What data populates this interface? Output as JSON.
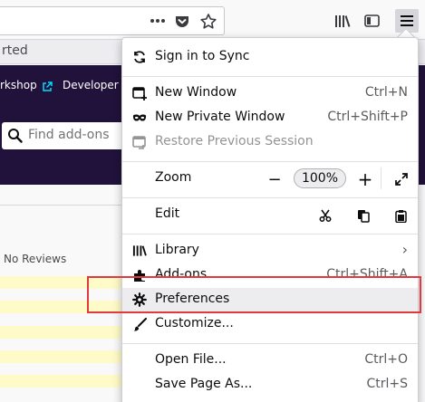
{
  "toolbar": {
    "icons": [
      "page-actions-icon",
      "pocket-icon",
      "bookmark-star-icon",
      "library-icon",
      "sidebar-icon",
      "hamburger-menu-icon"
    ]
  },
  "tab": {
    "title_fragment": "rted"
  },
  "page": {
    "links": [
      {
        "label": "rkshop",
        "icon": "external-link-icon"
      },
      {
        "label": "Developer H",
        "icon": ""
      }
    ],
    "search_placeholder": "Find add-ons",
    "reviews": "No Reviews"
  },
  "menu": {
    "sync": {
      "label": "Sign in to Sync",
      "icon": "sync-icon"
    },
    "new_window": {
      "label": "New Window",
      "shortcut": "Ctrl+N",
      "icon": "new-window-icon"
    },
    "private_window": {
      "label": "New Private Window",
      "shortcut": "Ctrl+Shift+P",
      "icon": "private-mask-icon"
    },
    "restore_session": {
      "label": "Restore Previous Session",
      "icon": "restore-session-icon",
      "disabled": true
    },
    "zoom": {
      "label": "Zoom",
      "value": "100%",
      "minus": "−",
      "plus": "+",
      "fullscreen_icon": "fullscreen-icon"
    },
    "edit": {
      "label": "Edit",
      "icons": [
        "cut-icon",
        "copy-icon",
        "paste-icon"
      ]
    },
    "library": {
      "label": "Library",
      "icon": "library-icon",
      "arrow": "›"
    },
    "addons": {
      "label": "Add-ons",
      "shortcut": "Ctrl+Shift+A",
      "icon": "puzzle-piece-icon"
    },
    "preferences": {
      "label": "Preferences",
      "icon": "gear-icon"
    },
    "customize": {
      "label": "Customize...",
      "icon": "paintbrush-icon"
    },
    "open_file": {
      "label": "Open File...",
      "shortcut": "Ctrl+O"
    },
    "save_page": {
      "label": "Save Page As...",
      "shortcut": "Ctrl+S"
    }
  },
  "colors": {
    "hero_bg": "#20123a",
    "highlight": "#e0393e",
    "stripe": "#fffbc9",
    "link_icon": "#00ddff"
  }
}
